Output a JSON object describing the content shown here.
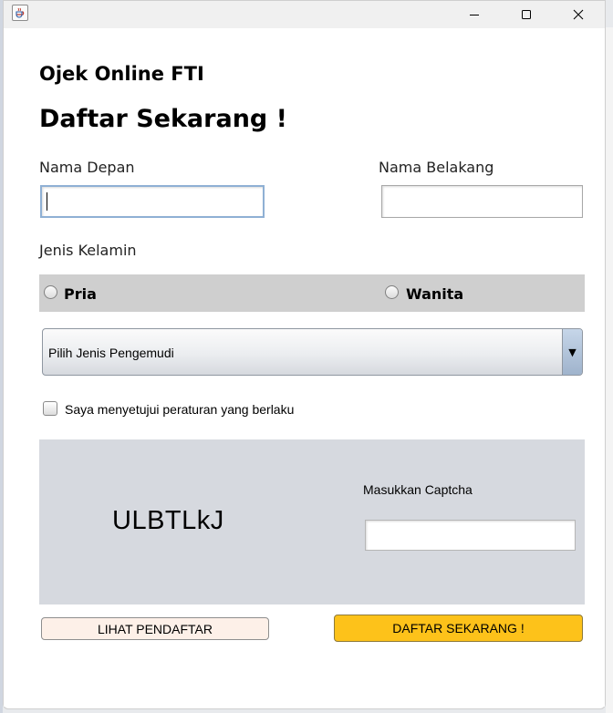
{
  "window": {
    "controls": [
      "minimize-icon",
      "maximize-icon",
      "close-icon"
    ]
  },
  "header": {
    "app_name": "Ojek Online FTI",
    "headline": "Daftar Sekarang !"
  },
  "form": {
    "first_name_label": "Nama Depan",
    "first_name_value": "",
    "last_name_label": "Nama Belakang",
    "last_name_value": "",
    "gender_label": "Jenis Kelamin",
    "gender_options": [
      "Pria",
      "Wanita"
    ],
    "gender_selected": "",
    "driver_type_selected": "Pilih Jenis Pengemudi",
    "agree_label": "Saya menyetujui peraturan yang berlaku",
    "agree_checked": false
  },
  "captcha": {
    "code": "ULBTLkJ",
    "label": "Masukkan Captcha",
    "value": ""
  },
  "buttons": {
    "view_registrants": "LIHAT PENDAFTAR",
    "register_now": "DAFTAR SEKARANG !"
  },
  "colors": {
    "register_button": "#fdc21a",
    "view_button": "#fdf0e8",
    "gender_bar": "#cfcfcf",
    "captcha_panel": "#d6d9df"
  }
}
